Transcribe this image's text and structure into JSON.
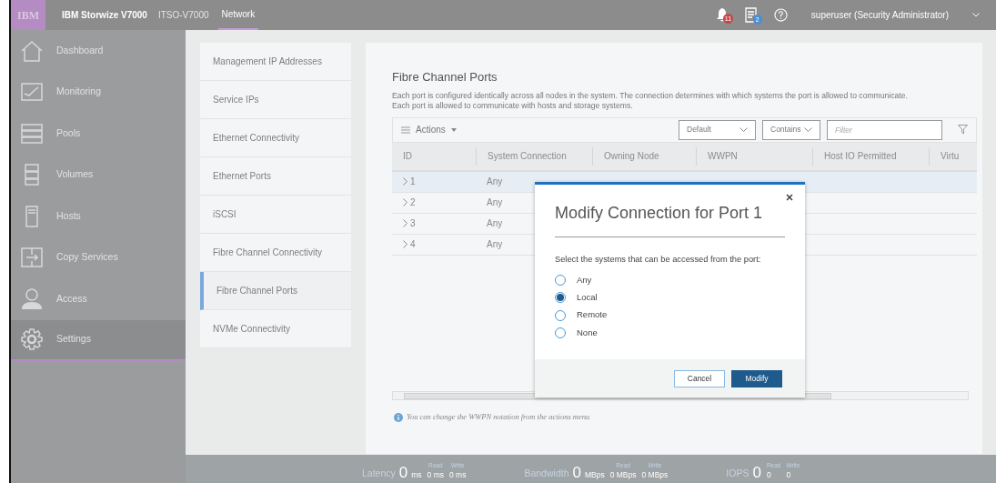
{
  "header": {
    "logo": "IBM",
    "product": "IBM Storwize V7000",
    "system": "ITSO-V7000",
    "page": "Network",
    "alerts": "11",
    "tasks": "2",
    "user": "superuser (Security Administrator)"
  },
  "sidebar": {
    "items": [
      {
        "label": "Dashboard",
        "selected": false
      },
      {
        "label": "Monitoring",
        "selected": false
      },
      {
        "label": "Pools",
        "selected": false
      },
      {
        "label": "Volumes",
        "selected": false
      },
      {
        "label": "Hosts",
        "selected": false
      },
      {
        "label": "Copy Services",
        "selected": false
      },
      {
        "label": "Access",
        "selected": false
      },
      {
        "label": "Settings",
        "selected": true
      }
    ]
  },
  "submenu": {
    "items": [
      {
        "label": "Management IP Addresses",
        "selected": false
      },
      {
        "label": "Service IPs",
        "selected": false
      },
      {
        "label": "Ethernet Connectivity",
        "selected": false
      },
      {
        "label": "Ethernet Ports",
        "selected": false
      },
      {
        "label": "iSCSI",
        "selected": false
      },
      {
        "label": "Fibre Channel Connectivity",
        "selected": false
      },
      {
        "label": "Fibre Channel Ports",
        "selected": true
      },
      {
        "label": "NVMe Connectivity",
        "selected": false
      }
    ]
  },
  "panel": {
    "title": "Fibre Channel Ports",
    "description": [
      "Each port is configured identically across all nodes in the system. The connection determines with which systems the port is allowed to communicate.",
      "Each port is allowed to communicate with hosts and storage systems."
    ],
    "toolbar": {
      "actions": "Actions",
      "view": "Default",
      "match": "Contains",
      "filter_placeholder": "Filter"
    },
    "table": {
      "columns": [
        "ID",
        "System Connection",
        "Owning Node",
        "WWPN",
        "Host IO Permitted",
        "Virtu"
      ],
      "rows": [
        {
          "id": "1",
          "connection": "Any",
          "selected": true
        },
        {
          "id": "2",
          "connection": "Any",
          "selected": false
        },
        {
          "id": "3",
          "connection": "Any",
          "selected": false
        },
        {
          "id": "4",
          "connection": "Any",
          "selected": false
        }
      ]
    },
    "note": "You can change the WWPN notation from the actions menu"
  },
  "modal": {
    "title": "Modify Connection for Port 1",
    "prompt": "Select the systems that can be accessed from the port:",
    "options": [
      {
        "label": "Any",
        "selected": false
      },
      {
        "label": "Local",
        "selected": true
      },
      {
        "label": "Remote",
        "selected": false
      },
      {
        "label": "None",
        "selected": false
      }
    ],
    "cancel": "Cancel",
    "confirm": "Modify"
  },
  "status_bar": {
    "metrics": [
      {
        "name": "Latency",
        "value": "0",
        "unit": "ms",
        "read_label": "Read",
        "read": "0 ms",
        "write_label": "Write",
        "write": "0 ms"
      },
      {
        "name": "Bandwidth",
        "value": "0",
        "unit": "MBps",
        "read_label": "Read",
        "read": "0 MBps",
        "write_label": "Write",
        "write": "0 MBps"
      },
      {
        "name": "IOPS",
        "value": "0",
        "read_label": "Read",
        "read": "0",
        "write_label": "Write",
        "write": "0"
      }
    ]
  }
}
